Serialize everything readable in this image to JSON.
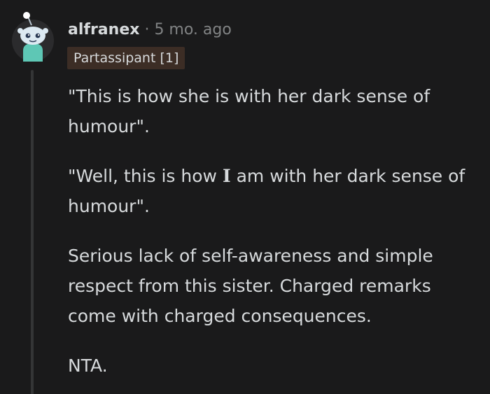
{
  "comment": {
    "author": "alfranex",
    "separator": "·",
    "timestamp": "5 mo. ago",
    "flair": "Partassipant [1]",
    "paragraphs": [
      {
        "text": "\"This is how she is with her dark sense of humour\"."
      },
      {
        "before": "\"Well, this is how ",
        "bold": "I",
        "after": " am with her dark sense of humour\"."
      },
      {
        "text": "Serious lack of self-awareness and simple respect from this sister. Charged remarks come with charged consequences."
      },
      {
        "text": "NTA."
      }
    ]
  },
  "avatar": {
    "icon": "snoo-avatar-icon",
    "body_color": "#5ec7b5",
    "head_color": "#dce9f2",
    "background": "#2b2b2d"
  },
  "colors": {
    "background": "#1a1a1b",
    "text": "#d7dadc",
    "meta": "#818384",
    "flair_bg": "#3c2d25",
    "thread_line": "#343536"
  }
}
